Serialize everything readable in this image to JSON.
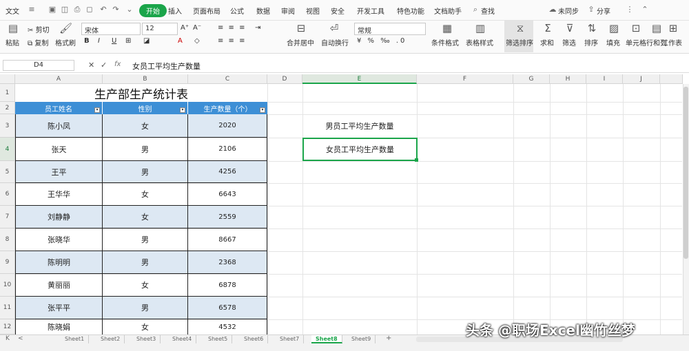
{
  "menu": {
    "app": "文文",
    "items": [
      "开始",
      "插入",
      "页面布局",
      "公式",
      "数据",
      "审阅",
      "视图",
      "安全",
      "开发工具",
      "特色功能",
      "文档助手"
    ],
    "active_index": 0,
    "search": "查找",
    "right": [
      "未同步",
      "分享"
    ]
  },
  "ribbon": {
    "cut": "剪切",
    "copy": "复制",
    "paste": "粘贴",
    "format_painter": "格式刷",
    "font_name": "宋体",
    "font_size": "12",
    "merge": "合并居中",
    "wrap": "自动换行",
    "number_format": "常规",
    "cond_format": "条件格式",
    "table_style": "表格样式",
    "filter_sort": "筛选排序",
    "sum": "求和",
    "filter": "筛选",
    "sort": "排序",
    "fill": "填充",
    "cell": "单元格",
    "rows_cols": "行和列",
    "worksheet": "工作表"
  },
  "formula": {
    "name_box": "D4",
    "content": "女员工平均生产数量"
  },
  "columns": [
    "A",
    "B",
    "C",
    "D",
    "E",
    "F",
    "G",
    "H",
    "I",
    "J"
  ],
  "rows": [
    "1",
    "2",
    "3",
    "4",
    "5",
    "6",
    "7",
    "8",
    "9",
    "10",
    "11",
    "12"
  ],
  "table": {
    "title": "生产部生产统计表",
    "headers": [
      "员工姓名",
      "性别",
      "生产数量（个）"
    ],
    "data": [
      [
        "陈小凤",
        "女",
        "2020"
      ],
      [
        "张天",
        "男",
        "2106"
      ],
      [
        "王平",
        "男",
        "4256"
      ],
      [
        "王华华",
        "女",
        "6643"
      ],
      [
        "刘静静",
        "女",
        "2559"
      ],
      [
        "张晓华",
        "男",
        "8667"
      ],
      [
        "陈明明",
        "男",
        "2368"
      ],
      [
        "黄丽丽",
        "女",
        "6878"
      ],
      [
        "张平平",
        "男",
        "6578"
      ],
      [
        "陈晓娟",
        "女",
        "4532"
      ]
    ]
  },
  "side": {
    "d3": "男员工平均生产数量",
    "d4": "女员工平均生产数量"
  },
  "sheets": [
    "Sheet1",
    "Sheet2",
    "Sheet3",
    "Sheet4",
    "Sheet5",
    "Sheet6",
    "Sheet7",
    "Sheet8",
    "Sheet9"
  ],
  "active_sheet_index": 7,
  "watermark": "头条 @职场Excel幽竹丝梦"
}
